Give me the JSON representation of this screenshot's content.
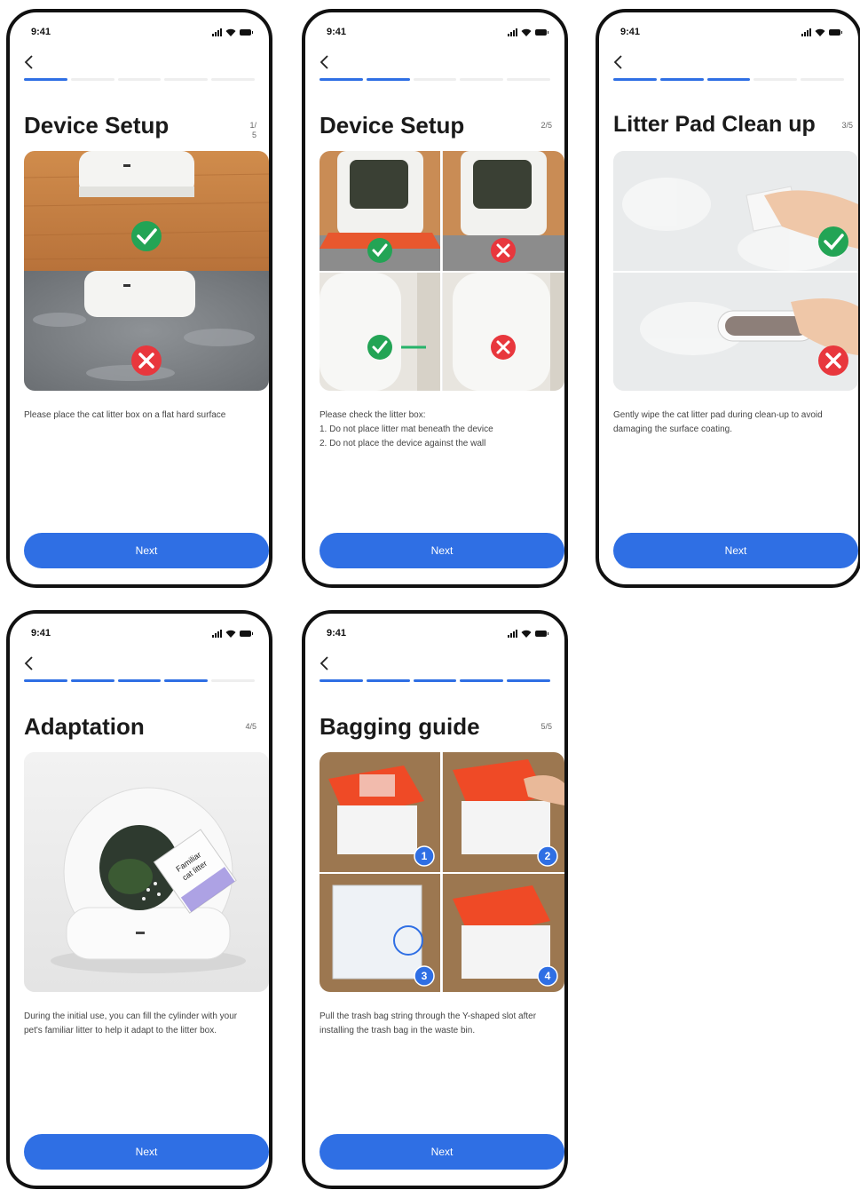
{
  "colors": {
    "accent": "#2f6fe4",
    "check_green": "#23a455",
    "cross_red": "#e8373d"
  },
  "screens": [
    {
      "time": "9:41",
      "title": "Device Setup",
      "step": "1/5",
      "progress_total": 5,
      "progress_done": 1,
      "description": [
        "Please place the cat litter box on a flat hard surface"
      ],
      "next_label": "Next"
    },
    {
      "time": "9:41",
      "title": "Device Setup",
      "step": "2/5",
      "progress_total": 5,
      "progress_done": 2,
      "description": [
        "Please check the litter box:",
        "1. Do not place litter mat beneath the device",
        "2. Do not place the device against the wall"
      ],
      "next_label": "Next"
    },
    {
      "time": "9:41",
      "title": "Litter Pad Clean up",
      "step": "3/5",
      "progress_total": 5,
      "progress_done": 3,
      "description": [
        "Gently wipe the cat litter pad during clean-up to avoid damaging the surface coating."
      ],
      "next_label": "Next"
    },
    {
      "time": "9:41",
      "title": "Adaptation",
      "step": "4/5",
      "progress_total": 5,
      "progress_done": 4,
      "description": [
        "During the initial use, you can fill the cylinder with your pet's familiar litter to help it adapt to the litter box."
      ],
      "image_text": "Familiar cat litter",
      "next_label": "Next"
    },
    {
      "time": "9:41",
      "title": "Bagging guide",
      "step": "5/5",
      "progress_total": 5,
      "progress_done": 5,
      "description": [
        "Pull the trash bag string through the Y-shaped slot after installing the trash bag in the waste bin."
      ],
      "badges": [
        "1",
        "2",
        "3",
        "4"
      ],
      "next_label": "Next"
    }
  ]
}
